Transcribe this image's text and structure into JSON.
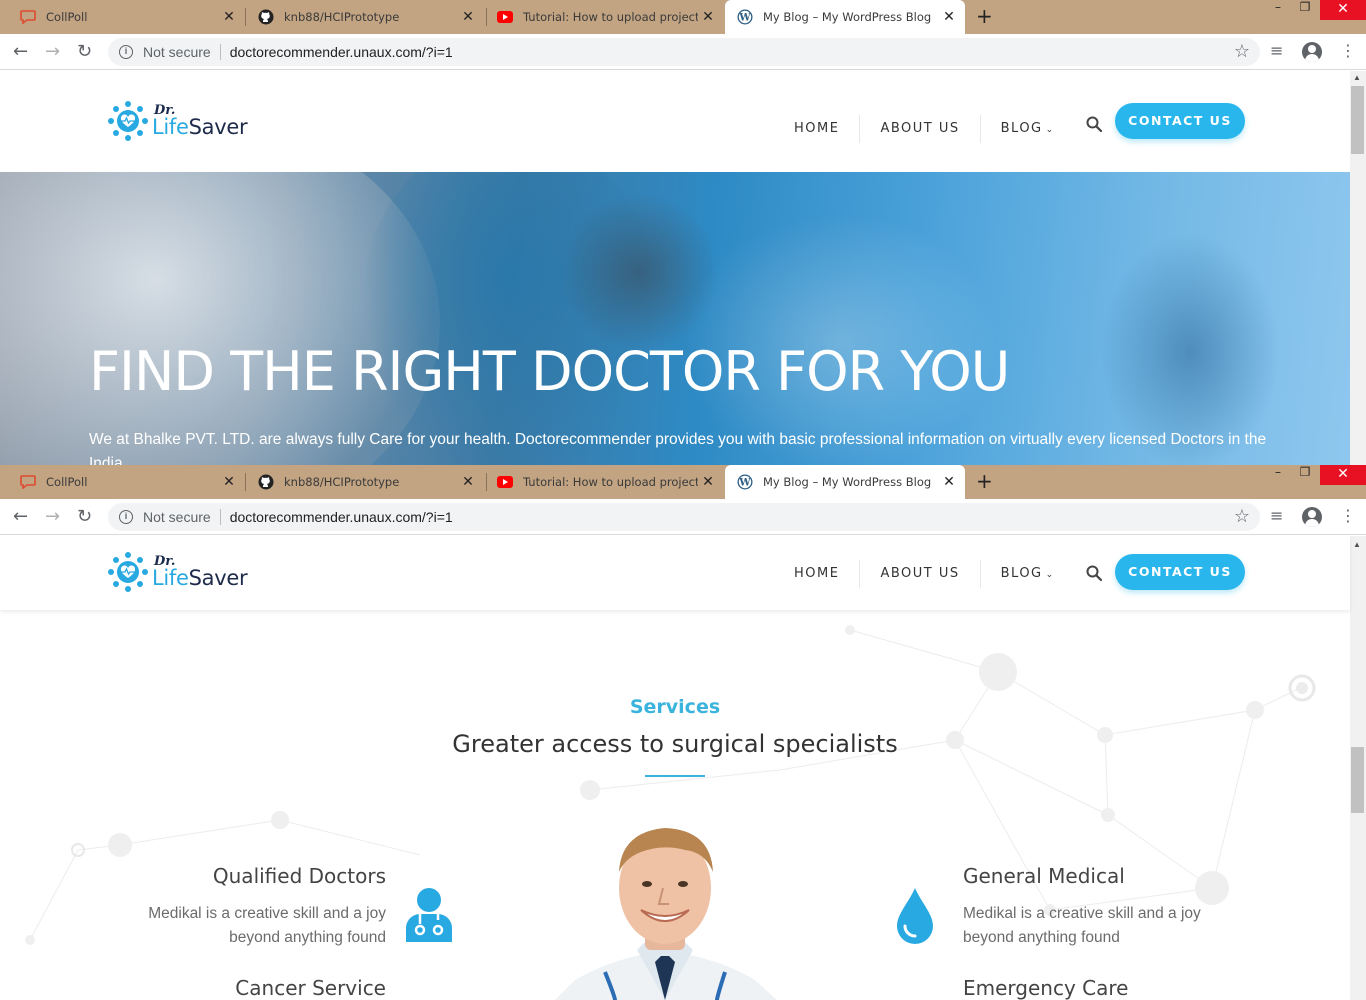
{
  "browser": {
    "tabs": [
      {
        "title": "CollPoll",
        "icon": "speech-bubble-icon"
      },
      {
        "title": "knb88/HCIPrototype",
        "icon": "github-icon"
      },
      {
        "title": "Tutorial: How to upload project t",
        "icon": "youtube-icon"
      },
      {
        "title": "My Blog – My WordPress Blog",
        "icon": "wordpress-icon",
        "active": true
      }
    ],
    "new_tab": "+",
    "close_glyph": "✕",
    "security_label": "Not secure",
    "url": "doctorecommender.unaux.com/?i=1"
  },
  "site": {
    "logo_dr": "Dr.",
    "logo_life": "Life",
    "logo_saver": "Saver",
    "nav": [
      "HOME",
      "ABOUT US",
      "BLOG"
    ],
    "contact_label": "CONTACT US",
    "accent": "#29b6ec"
  },
  "hero": {
    "title": "FIND THE RIGHT DOCTOR FOR YOU",
    "subtitle": "We at Bhalke PVT. LTD. are always fully Care for your health. Doctorecommender provides you with basic professional information on virtually every licensed Doctors in the India."
  },
  "services": {
    "kicker": "Services",
    "heading": "Greater access to surgical specialists",
    "features": [
      {
        "title": "Qualified Doctors",
        "text": "Medikal is a creative skill and a joy beyond anything found",
        "icon": "doctor-icon"
      },
      {
        "title": "General Medical",
        "text": "Medikal is a creative skill and a joy beyond anything found",
        "icon": "water-drop-icon"
      },
      {
        "title": "Cancer Service",
        "text": ""
      },
      {
        "title": "Emergency Care",
        "text": ""
      }
    ]
  }
}
